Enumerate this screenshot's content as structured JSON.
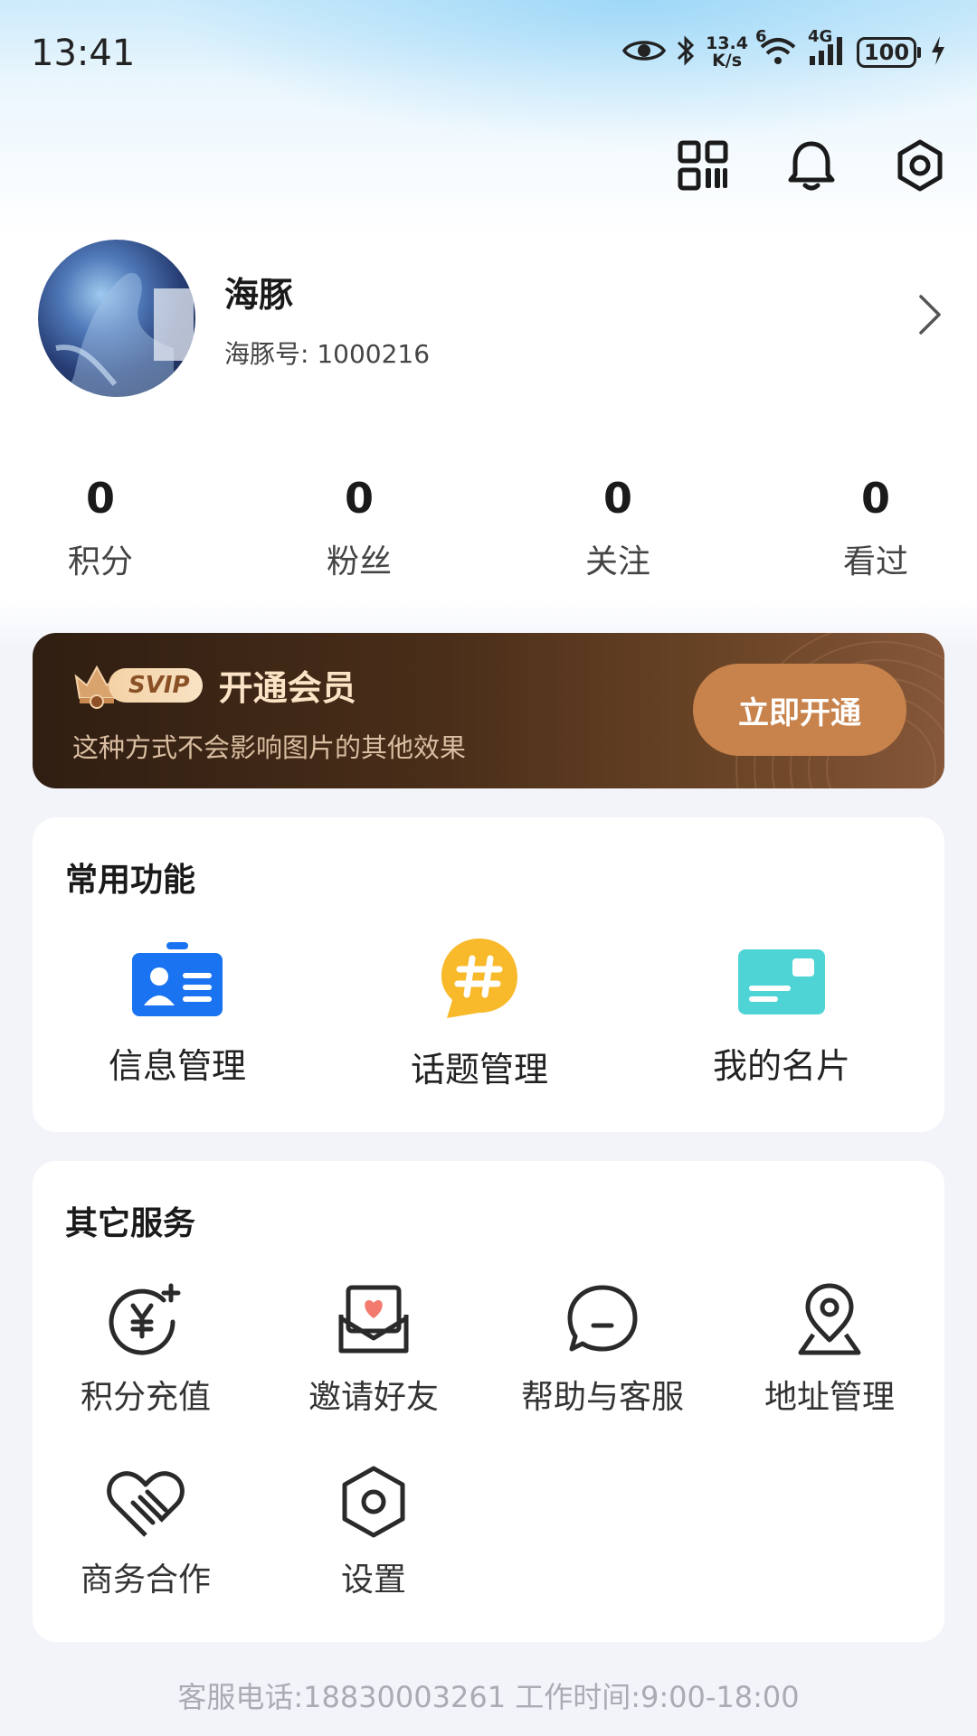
{
  "status_bar": {
    "time": "13:41",
    "speed_value": "13.4",
    "speed_unit": "K/s",
    "wifi_badge": "6",
    "network": "4G",
    "battery": "100",
    "icons": [
      "eye-icon",
      "bluetooth-icon",
      "wifi-icon",
      "signal-icon",
      "battery-icon",
      "charging-icon"
    ]
  },
  "header": {
    "icons": [
      "qrcode-icon",
      "bell-icon",
      "settings-icon"
    ]
  },
  "profile": {
    "name": "海豚",
    "id_text": "海豚号: 1000216"
  },
  "stats": [
    {
      "value": "0",
      "label": "积分"
    },
    {
      "value": "0",
      "label": "粉丝"
    },
    {
      "value": "0",
      "label": "关注"
    },
    {
      "value": "0",
      "label": "看过"
    }
  ],
  "vip": {
    "badge": "SVIP",
    "title": "开通会员",
    "subtitle": "这种方式不会影响图片的其他效果",
    "button": "立即开通"
  },
  "common_tools": {
    "title": "常用功能",
    "items": [
      {
        "label": "信息管理",
        "icon": "id-card-icon"
      },
      {
        "label": "话题管理",
        "icon": "hashtag-icon"
      },
      {
        "label": "我的名片",
        "icon": "business-card-icon"
      }
    ]
  },
  "other_services": {
    "title": "其它服务",
    "items": [
      {
        "label": "积分充值",
        "icon": "yuan-plus-icon"
      },
      {
        "label": "邀请好友",
        "icon": "heart-envelope-icon"
      },
      {
        "label": "帮助与客服",
        "icon": "chat-bubble-icon"
      },
      {
        "label": "地址管理",
        "icon": "location-pin-icon"
      },
      {
        "label": "商务合作",
        "icon": "handshake-heart-icon"
      },
      {
        "label": "设置",
        "icon": "settings-hexagon-icon"
      }
    ]
  },
  "footer": {
    "text": "客服电话:18830003261 工作时间:9:00-18:00"
  },
  "colors": {
    "accent_blue": "#1a73f0",
    "topic_yellow": "#f8b92a",
    "card_teal": "#4fd4d6",
    "vip_button": "#c8834c",
    "vip_gold_text": "#fbe3c5"
  }
}
